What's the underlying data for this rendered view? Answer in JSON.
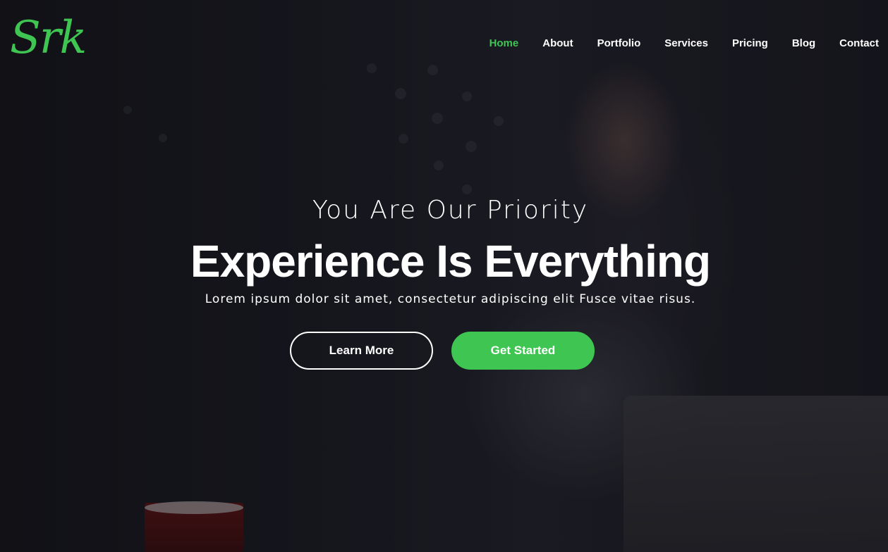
{
  "brand": {
    "logo_text": "Srk",
    "accent_color": "#3fc552"
  },
  "nav": {
    "items": [
      {
        "label": "Home",
        "active": true
      },
      {
        "label": "About",
        "active": false
      },
      {
        "label": "Portfolio",
        "active": false
      },
      {
        "label": "Services",
        "active": false
      },
      {
        "label": "Pricing",
        "active": false
      },
      {
        "label": "Blog",
        "active": false
      },
      {
        "label": "Contact",
        "active": false
      }
    ]
  },
  "hero": {
    "subtitle": "You Are Our Priority",
    "headline": "Experience Is Everything",
    "description": "Lorem ipsum dolor sit amet, consectetur adipiscing elit Fusce vitae risus.",
    "buttons": {
      "secondary_label": "Learn More",
      "primary_label": "Get Started"
    }
  }
}
